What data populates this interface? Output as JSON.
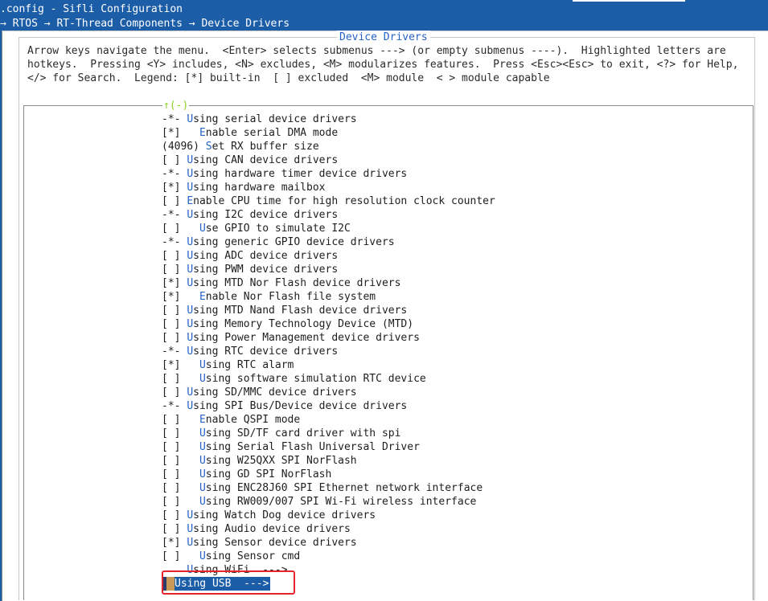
{
  "window": {
    "title": ".config - Sifli Configuration",
    "breadcrumb": "→ RTOS → RT-Thread Components → Device Drivers"
  },
  "dialog": {
    "title": "Device Drivers",
    "help_lines": [
      "Arrow keys navigate the menu.  <Enter> selects submenus ---> (or empty submenus ----).  Highlighted letters are",
      "hotkeys.  Pressing <Y> includes, <N> excludes, <M> modularizes features.  Press <Esc><Esc> to exit, <?> for Help,",
      "</> for Search.  Legend: [*] built-in  [ ] excluded  <M> module  < > module capable"
    ],
    "scroll_indicator": "↑(-)"
  },
  "menu": {
    "items": [
      {
        "prefix": "-*- ",
        "hotkey": "U",
        "rest": "sing serial device drivers"
      },
      {
        "prefix": "[*]   ",
        "hotkey": "E",
        "rest": "nable serial DMA mode"
      },
      {
        "prefix": "(4096) ",
        "hotkey": "S",
        "rest": "et RX buffer size"
      },
      {
        "prefix": "[ ] ",
        "hotkey": "U",
        "rest": "sing CAN device drivers"
      },
      {
        "prefix": "-*- ",
        "hotkey": "U",
        "rest": "sing hardware timer device drivers"
      },
      {
        "prefix": "[*] ",
        "hotkey": "U",
        "rest": "sing hardware mailbox"
      },
      {
        "prefix": "[ ] ",
        "hotkey": "E",
        "rest": "nable CPU time for high resolution clock counter"
      },
      {
        "prefix": "-*- ",
        "hotkey": "U",
        "rest": "sing I2C device drivers"
      },
      {
        "prefix": "[ ]   ",
        "hotkey": "U",
        "rest": "se GPIO to simulate I2C"
      },
      {
        "prefix": "-*- ",
        "hotkey": "U",
        "rest": "sing generic GPIO device drivers"
      },
      {
        "prefix": "[ ] ",
        "hotkey": "U",
        "rest": "sing ADC device drivers"
      },
      {
        "prefix": "[ ] ",
        "hotkey": "U",
        "rest": "sing PWM device drivers"
      },
      {
        "prefix": "[*] ",
        "hotkey": "U",
        "rest": "sing MTD Nor Flash device drivers"
      },
      {
        "prefix": "[*]   ",
        "hotkey": "E",
        "rest": "nable Nor Flash file system"
      },
      {
        "prefix": "[ ] ",
        "hotkey": "U",
        "rest": "sing MTD Nand Flash device drivers"
      },
      {
        "prefix": "[ ] ",
        "hotkey": "U",
        "rest": "sing Memory Technology Device (MTD)"
      },
      {
        "prefix": "[ ] ",
        "hotkey": "U",
        "rest": "sing Power Management device drivers"
      },
      {
        "prefix": "-*- ",
        "hotkey": "U",
        "rest": "sing RTC device drivers"
      },
      {
        "prefix": "[*]   ",
        "hotkey": "U",
        "rest": "sing RTC alarm"
      },
      {
        "prefix": "[ ]   ",
        "hotkey": "U",
        "rest": "sing software simulation RTC device"
      },
      {
        "prefix": "[ ] ",
        "hotkey": "U",
        "rest": "sing SD/MMC device drivers"
      },
      {
        "prefix": "-*- ",
        "hotkey": "U",
        "rest": "sing SPI Bus/Device device drivers"
      },
      {
        "prefix": "[ ]   ",
        "hotkey": "E",
        "rest": "nable QSPI mode"
      },
      {
        "prefix": "[ ]   ",
        "hotkey": "U",
        "rest": "sing SD/TF card driver with spi"
      },
      {
        "prefix": "[ ]   ",
        "hotkey": "U",
        "rest": "sing Serial Flash Universal Driver"
      },
      {
        "prefix": "[ ]   ",
        "hotkey": "U",
        "rest": "sing W25QXX SPI NorFlash"
      },
      {
        "prefix": "[ ]   ",
        "hotkey": "U",
        "rest": "sing GD SPI NorFlash"
      },
      {
        "prefix": "[ ]   ",
        "hotkey": "U",
        "rest": "sing ENC28J60 SPI Ethernet network interface"
      },
      {
        "prefix": "[ ]   ",
        "hotkey": "U",
        "rest": "sing RW009/007 SPI Wi-Fi wireless interface"
      },
      {
        "prefix": "[ ] ",
        "hotkey": "U",
        "rest": "sing Watch Dog device drivers"
      },
      {
        "prefix": "[ ] ",
        "hotkey": "U",
        "rest": "sing Audio device drivers"
      },
      {
        "prefix": "[*] ",
        "hotkey": "U",
        "rest": "sing Sensor device drivers"
      },
      {
        "prefix": "[ ]   ",
        "hotkey": "U",
        "rest": "sing Sensor cmd"
      },
      {
        "prefix": "    ",
        "hotkey": "U",
        "rest": "sing WiFi  --->"
      }
    ],
    "selected": {
      "label": "Using USB  --->"
    }
  },
  "colors": {
    "terminal_bg": "#1c5da8",
    "hotkey": "#2563c9",
    "scroll_hint": "#8bd12b",
    "annotation_box": "#e5242b"
  }
}
